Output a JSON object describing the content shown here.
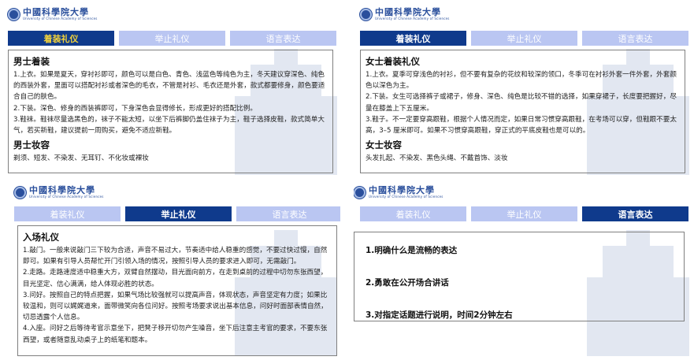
{
  "logo": {
    "cn": "中國科學院大學",
    "en": "University of Chinese Academy of Sciences"
  },
  "tabs": [
    "着装礼仪",
    "举止礼仪",
    "语言表达"
  ],
  "panel1": {
    "title_male_dress": "男士着装",
    "paras": [
      "1.上衣。如果是夏天，穿衬衫即可，颜色可以是白色、青色、浅蓝色等纯色为主，冬天建议穿深色、纯色的西装外套，里面可以搭配衬衫或者深色的毛衣，不管是衬衫、毛衣还是外套，款式都要修身，颜色要适合自己的肤色。",
      "2.下装。深色、修身的西装裤即可，下身深色会显得修长，形成更好的搭配比例。",
      "3.鞋袜。鞋袜尽量选黑色的，袜子不能太短，以坐下后裤脚仍盖住袜子为主，鞋子选择皮鞋，款式简单大气，若买新鞋，建议提前一周购买，避免不适应新鞋。"
    ],
    "title_male_makeup": "男士妆容",
    "makeup": "剃须、短发、不染发、无耳钉、不化妆或裸妆"
  },
  "panel2": {
    "title_female_dress": "女士着装礼仪",
    "paras": [
      "1.上衣。夏季可穿浅色的衬衫，但不要有复杂的花纹和较深的领口，冬季可在衬衫外套一件外套，外套颜色以深色为主。",
      "2.下装。女生可选择裤子或裙子，修身、深色、纯色是比较不错的选择，如果穿裙子，长度要把握好，尽量在膝盖上下五厘米。",
      "3.鞋子。不一定要穿高跟鞋，根据个人情况而定，如果日常习惯穿高跟鞋，在考场可以穿，但鞋跟不要太高，3–5 厘米即可。如果不习惯穿高跟鞋，穿正式的平底皮鞋也是可以的。"
    ],
    "title_female_makeup": "女士妆容",
    "makeup": "头发扎起、不染发、黑色头绳、不戴首饰、淡妆"
  },
  "panel3": {
    "title": "入场礼仪",
    "paras": [
      "1.敲门。一般来说敲门三下较为合适，声音不易过大，节奏适中给人稳重的感觉，不要过快过慢，自然即可。如果有引导人员帮忙开门引领入场的情况，按照引导人员的要求进入即可，无需敲门。",
      "2.走路。走路速度适中稳重大方，双臂自然摆动，目光面向前方，在走到桌前的过程中切勿东张西望，目光坚定、信心满满，给人体现必胜的状态。",
      "3.问好。按照自己的特点把握，如果气场比较强就可以提高声音，体现状态，声音坚定有力度；如果比较温和，则可以娓娓道来，面带微笑向各位问好。按照考场要求说出基本信息，问好时面部表情自然，切忌透露个人信息。",
      "4.入座。问好之后等待考官示意坐下，把凳子移开切勿产生噪音，坐下后注意主考官的要求，不要东张西望，或者随意乱动桌子上的纸笔和题本。"
    ]
  },
  "panel4": {
    "items": [
      "1.明确什么是流畅的表达",
      "2.勇敢在公开场合讲话",
      "3.对指定话题进行说明，时间2分钟左右"
    ]
  }
}
